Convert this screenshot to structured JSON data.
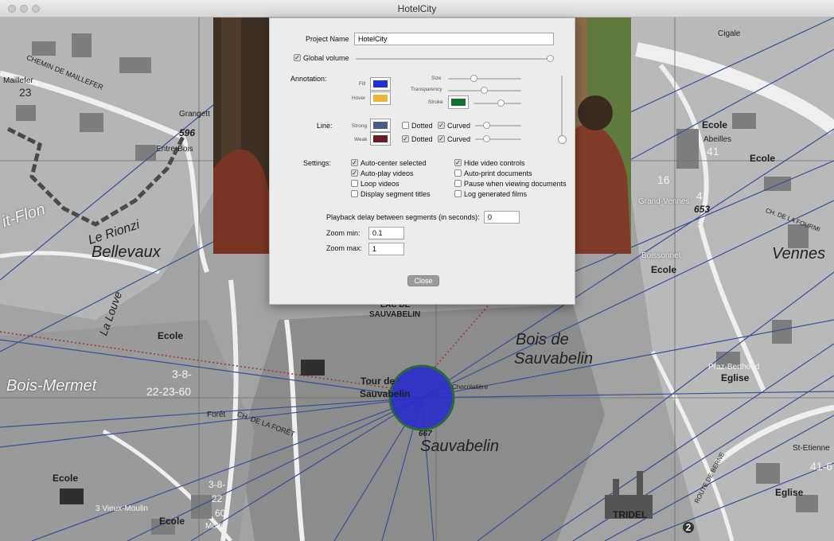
{
  "window": {
    "title": "HotelCity"
  },
  "dialog": {
    "project_name_label": "Project Name",
    "project_name_value": "HotelCity",
    "global_volume_label": "Global volume",
    "annotation_label": "Annotation:",
    "fill_label": "Fill",
    "hover_label": "Hover",
    "size_label": "Size",
    "transparency_label": "Transparency",
    "stroke_label": "Stroke",
    "line_label": "Line:",
    "strong_label": "Strong",
    "weak_label": "Weak",
    "dotted_label": "Dotted",
    "curved_label": "Curved",
    "settings_label": "Settings:",
    "settings_left": [
      {
        "label": "Auto-center selected",
        "checked": true
      },
      {
        "label": "Auto-play videos",
        "checked": true
      },
      {
        "label": "Loop videos",
        "checked": false
      },
      {
        "label": "Display segment titles",
        "checked": false
      }
    ],
    "settings_right": [
      {
        "label": "Hide video controls",
        "checked": true
      },
      {
        "label": "Auto-print documents",
        "checked": false
      },
      {
        "label": "Pause when viewing documents",
        "checked": false
      },
      {
        "label": "Log generated films",
        "checked": false
      }
    ],
    "playback_label": "Playback delay between segments (in seconds):",
    "playback_value": "0",
    "zoom_min_label": "Zoom min:",
    "zoom_min_value": "0.1",
    "zoom_max_label": "Zoom max:",
    "zoom_max_value": "1",
    "close_label": "Close",
    "colors": {
      "fill": "#1f2fd6",
      "hover": "#f0b43a",
      "stroke": "#107030",
      "strong": "#4a5a8a",
      "weak": "#6a1d24"
    }
  },
  "map": {
    "labels": {
      "cigale": "Cigale",
      "maillefer": "Maillefer",
      "n23": "23",
      "chemin_maillefer": "CHEMIN DE MAILLEFER",
      "grangette": "Grangett",
      "n596": "596",
      "entre_bois": "Entre-Bois",
      "it_flon": "it-Flon",
      "le_rionzi": "Le Rionzi",
      "bellevaux": "Bellevaux",
      "ecole": "Ecole",
      "abeilles": "Abeilles",
      "n41": "41",
      "n16": "16",
      "n653": "653",
      "grand_vennes": "Grand-Vennes",
      "boissonnet": "Boissonnet",
      "vennes": "Vennes",
      "lac_de": "LAC DE",
      "sauvabelin_caps": "SAUVABELIN",
      "bois_de": "Bois de",
      "sauvabelin_italic": "Sauvabelin",
      "tour_de": "Tour de",
      "sauvabelin_bold": "Sauvabelin",
      "chocolatiere": "Chocolatière",
      "n667": "667",
      "sauvabelin_lower": "Sauvabelin",
      "bois_mermet": "Bois-Mermet",
      "n38": "3-8-",
      "n2223": "22-23-60",
      "foret": "Forêt",
      "praz_berthoud": "Praz-Berthoud",
      "eglise": "Eglise",
      "st_etienne": "St-Etienne",
      "n41b": "41-6",
      "tridel": "TRIDEL",
      "vieux_moulin": "3 Vieux-Moulin",
      "motte": "Motte",
      "n60": "60",
      "n22": "22",
      "n38b": "3-8-",
      "ch_foret": "CH. DE LA FORÊT",
      "route_berne": "ROUTE DE BERNE",
      "ch_fourmi": "CH. DE LA FOURMI",
      "la_louve": "La Louve",
      "n2": "2",
      "cigale2": "Cigale"
    }
  }
}
